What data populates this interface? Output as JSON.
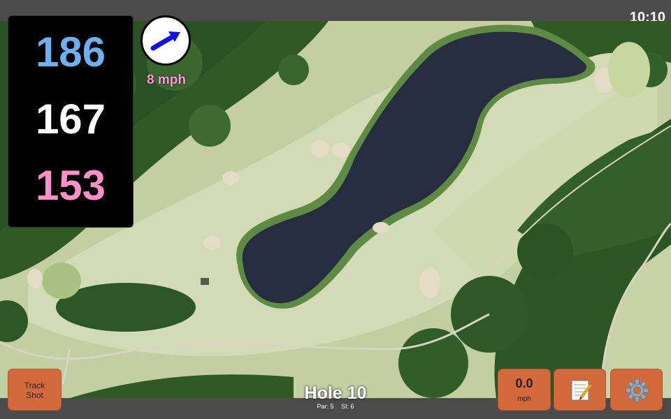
{
  "status": {
    "time": "10:10"
  },
  "distances": {
    "back": "186",
    "middle": "167",
    "front": "153"
  },
  "wind": {
    "speed_label": "8 mph",
    "arrow_icon": "arrow-right-up-icon"
  },
  "hole": {
    "title": "Hole 10",
    "par": "Par: 5",
    "si": "SI: 6"
  },
  "buttons": {
    "track_line1": "Track",
    "track_line2": "Shot",
    "speed_value": "0.0",
    "speed_unit": "mph",
    "notes_icon": "notepad-icon",
    "settings_icon": "gear-icon"
  },
  "colors": {
    "back_distance": "#6cb0f0",
    "middle_distance": "#ffffff",
    "front_distance": "#ff8fc8",
    "button_bg": "#d4693b"
  }
}
